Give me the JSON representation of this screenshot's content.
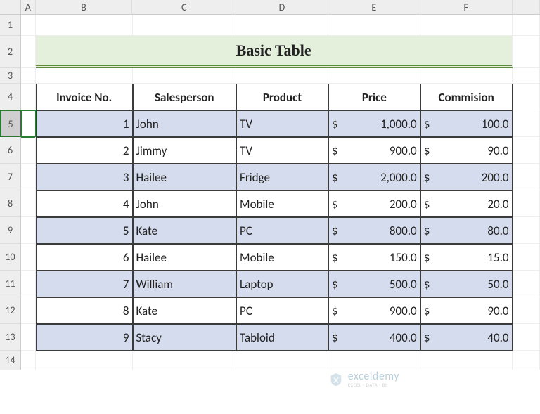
{
  "columns": [
    "A",
    "B",
    "C",
    "D",
    "E",
    "F"
  ],
  "row_labels": [
    "1",
    "2",
    "3",
    "4",
    "5",
    "6",
    "7",
    "8",
    "9",
    "10",
    "11",
    "12",
    "13",
    "14"
  ],
  "title": "Basic Table",
  "headers": {
    "invoice": "Invoice No.",
    "salesperson": "Salesperson",
    "product": "Product",
    "price": "Price",
    "commission": "Commision"
  },
  "currency_symbol": "$",
  "rows": [
    {
      "invoice": "1",
      "salesperson": "John",
      "product": "TV",
      "price": "1,000.0",
      "commission": "100.0"
    },
    {
      "invoice": "2",
      "salesperson": "Jimmy",
      "product": "TV",
      "price": "900.0",
      "commission": "90.0"
    },
    {
      "invoice": "3",
      "salesperson": "Hailee",
      "product": "Fridge",
      "price": "2,000.0",
      "commission": "200.0"
    },
    {
      "invoice": "4",
      "salesperson": "John",
      "product": "Mobile",
      "price": "200.0",
      "commission": "20.0"
    },
    {
      "invoice": "5",
      "salesperson": "Kate",
      "product": "PC",
      "price": "800.0",
      "commission": "80.0"
    },
    {
      "invoice": "6",
      "salesperson": "Hailee",
      "product": "Mobile",
      "price": "150.0",
      "commission": "15.0"
    },
    {
      "invoice": "7",
      "salesperson": "William",
      "product": "Laptop",
      "price": "500.0",
      "commission": "50.0"
    },
    {
      "invoice": "8",
      "salesperson": "Kate",
      "product": "PC",
      "price": "900.0",
      "commission": "90.0"
    },
    {
      "invoice": "9",
      "salesperson": "Stacy",
      "product": "Tabloid",
      "price": "400.0",
      "commission": "40.0"
    }
  ],
  "watermark": {
    "brand": "exceldemy",
    "tagline": "EXCEL · DATA · BI"
  },
  "selected_row_hdr": "5",
  "chart_data": {
    "type": "table",
    "title": "Basic Table",
    "columns": [
      "Invoice No.",
      "Salesperson",
      "Product",
      "Price",
      "Commision"
    ],
    "rows": [
      [
        1,
        "John",
        "TV",
        1000.0,
        100.0
      ],
      [
        2,
        "Jimmy",
        "TV",
        900.0,
        90.0
      ],
      [
        3,
        "Hailee",
        "Fridge",
        2000.0,
        200.0
      ],
      [
        4,
        "John",
        "Mobile",
        200.0,
        20.0
      ],
      [
        5,
        "Kate",
        "PC",
        800.0,
        80.0
      ],
      [
        6,
        "Hailee",
        "Mobile",
        150.0,
        15.0
      ],
      [
        7,
        "William",
        "Laptop",
        500.0,
        50.0
      ],
      [
        8,
        "Kate",
        "PC",
        900.0,
        90.0
      ],
      [
        9,
        "Stacy",
        "Tabloid",
        400.0,
        40.0
      ]
    ]
  }
}
